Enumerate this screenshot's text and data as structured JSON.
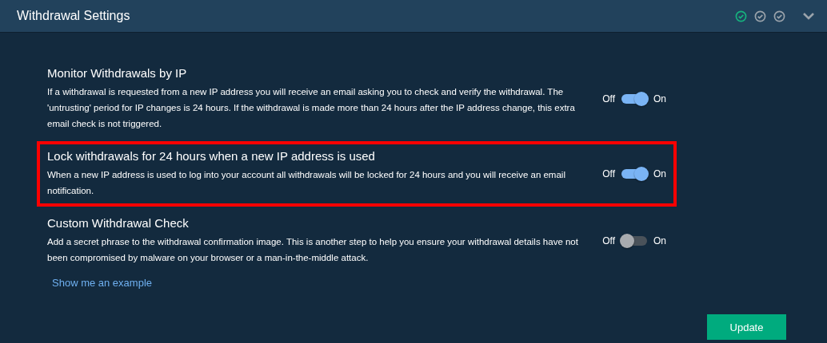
{
  "panel": {
    "title": "Withdrawal Settings",
    "steps": [
      {
        "done": true
      },
      {
        "done": false
      },
      {
        "done": false
      }
    ],
    "expanded": true
  },
  "settings": [
    {
      "title": "Monitor Withdrawals by IP",
      "description": "If a withdrawal is requested from a new IP address you will receive an email asking you to check and verify the withdrawal. The 'untrusting' period for IP changes is 24 hours. If the withdrawal is made more than 24 hours after the IP address change, this extra email check is not triggered.",
      "off_label": "Off",
      "on_label": "On",
      "on": true,
      "highlighted": false
    },
    {
      "title": "Lock withdrawals for 24 hours when a new IP address is used",
      "description": "When a new IP address is used to log into your account all withdrawals will be locked for 24 hours and you will receive an email notification.",
      "off_label": "Off",
      "on_label": "On",
      "on": true,
      "highlighted": true
    },
    {
      "title": "Custom Withdrawal Check",
      "description": "Add a secret phrase to the withdrawal confirmation image. This is another step to help you ensure your withdrawal details have not been compromised by malware on your browser or a man-in-the-middle attack.",
      "off_label": "Off",
      "on_label": "On",
      "on": false,
      "highlighted": false,
      "link": "Show me an example"
    }
  ],
  "update_button": "Update"
}
